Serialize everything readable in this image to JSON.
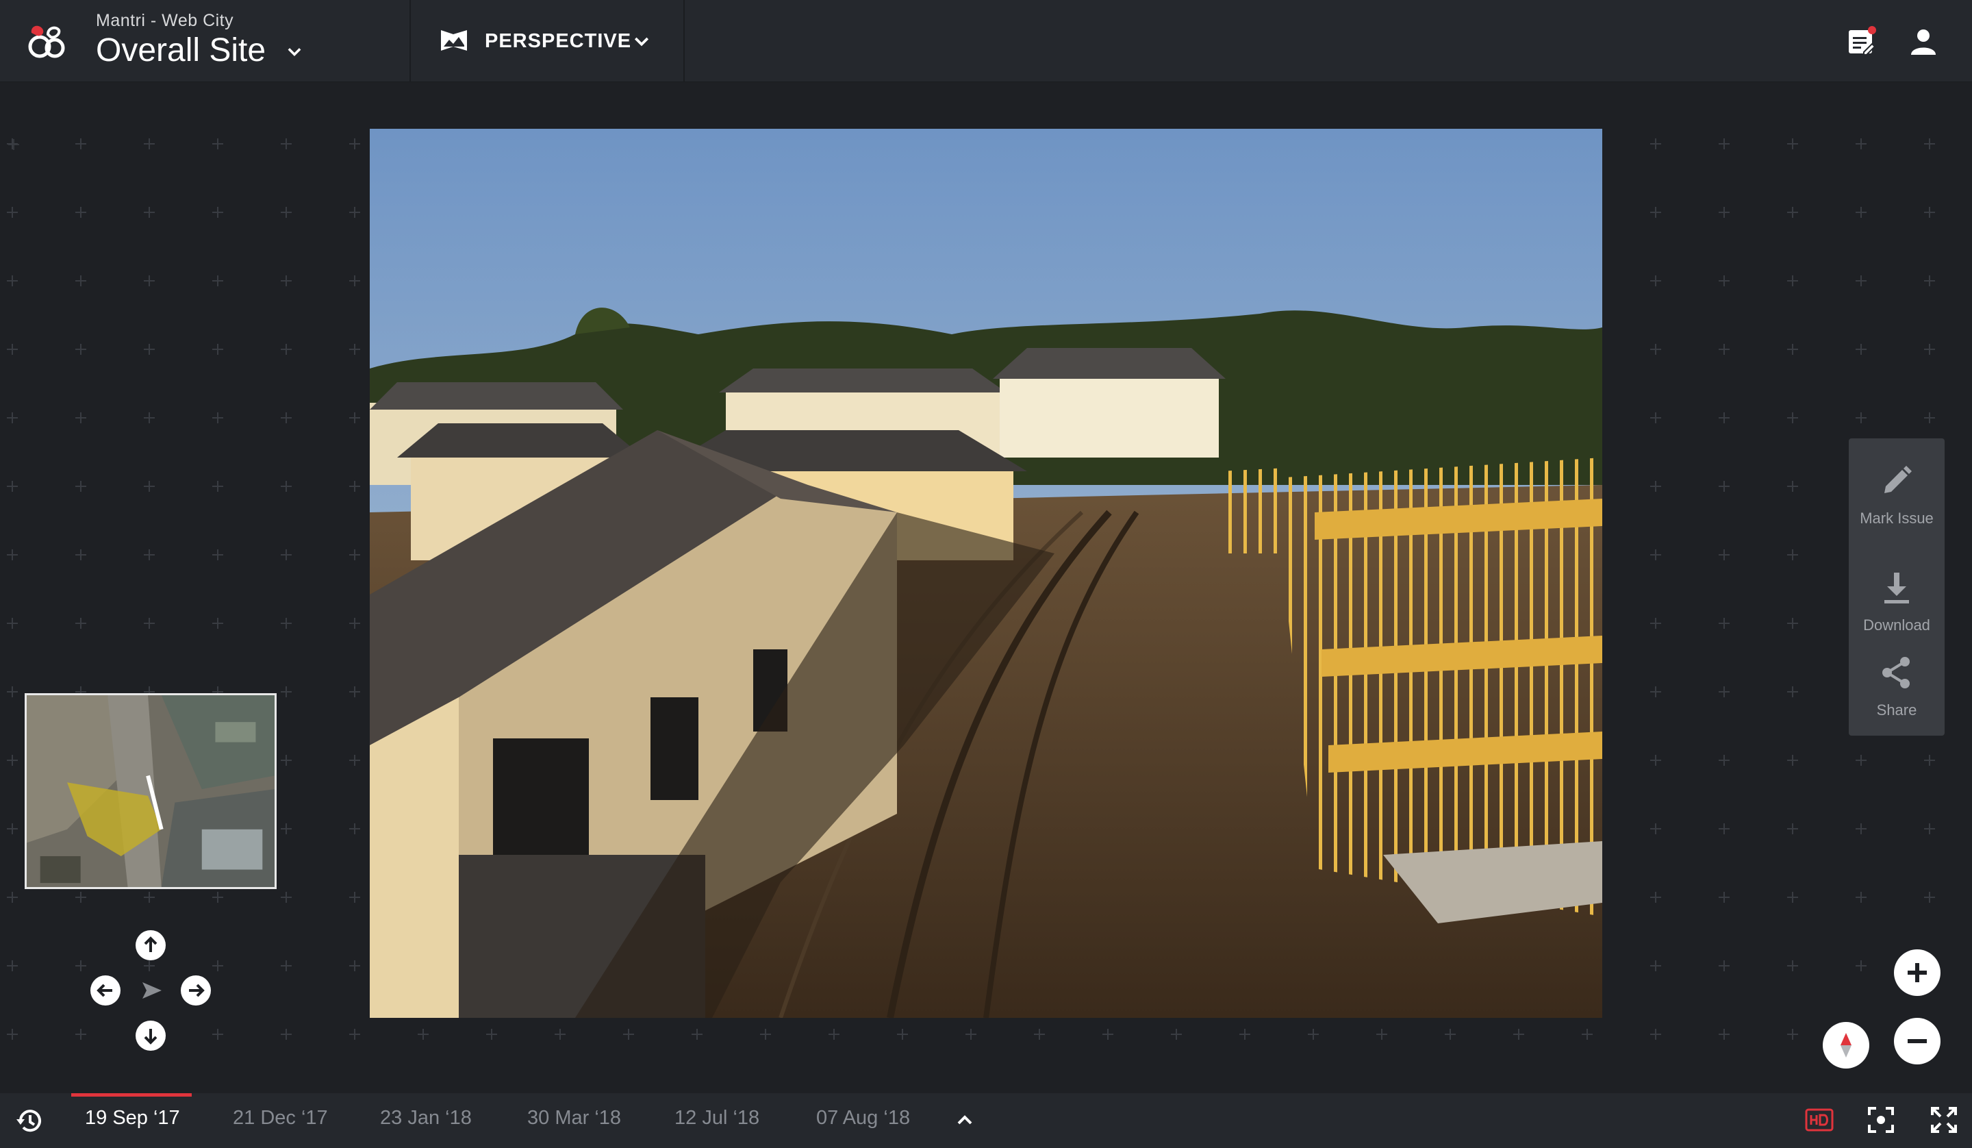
{
  "header": {
    "project_name": "Mantri - Web City",
    "site_name": "Overall Site",
    "view_mode": "PERSPECTIVE",
    "icons": [
      "mantri-logo",
      "chevron-down-icon",
      "perspective-icon",
      "notes-icon",
      "user-icon"
    ],
    "accent_color": "#e0343c"
  },
  "side_toolbar": {
    "items": [
      {
        "label": "Mark Issue",
        "icon": "pencil-icon"
      },
      {
        "label": "Download",
        "icon": "download-icon"
      },
      {
        "label": "Share",
        "icon": "share-icon"
      }
    ]
  },
  "navigation": {
    "icons": [
      "arrow-up-icon",
      "arrow-left-icon",
      "arrow-right-icon",
      "arrow-down-icon",
      "direction-pointer-icon"
    ]
  },
  "map_controls": {
    "icons": [
      "zoom-in-icon",
      "zoom-out-icon",
      "compass-icon"
    ]
  },
  "timeline": {
    "dates": [
      "19 Sep ‘17",
      "21 Dec ‘17",
      "23 Jan ‘18",
      "30 Mar ‘18",
      "12 Jul ‘18",
      "07 Aug ‘18"
    ],
    "active_index": 0,
    "icons": [
      "history-icon",
      "chevron-up-icon",
      "hd-icon",
      "focus-icon",
      "fullscreen-icon"
    ]
  }
}
